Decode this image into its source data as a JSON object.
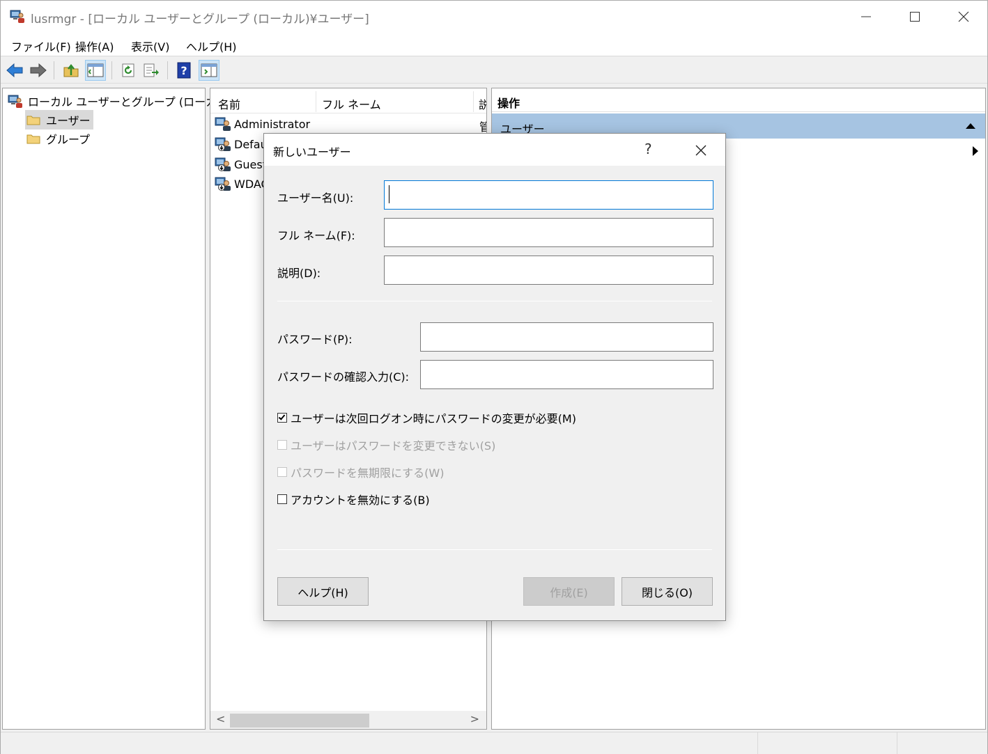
{
  "window": {
    "title": "lusrmgr - [ローカル ユーザーとグループ (ローカル)¥ユーザー]",
    "minimize": "—",
    "maximize": "☐",
    "close": "✕"
  },
  "menu": {
    "file": "ファイル(F)",
    "action": "操作(A)",
    "view": "表示(V)",
    "help": "ヘルプ(H)"
  },
  "toolbar": {
    "icons": [
      "back-icon",
      "forward-icon",
      "up-folder-icon",
      "show-hide-tree-icon",
      "refresh-icon",
      "export-list-icon",
      "help-icon",
      "show-hide-action-pane-icon"
    ]
  },
  "tree": {
    "root": "ローカル ユーザーとグループ (ローカル)",
    "users": "ユーザー",
    "groups": "グループ"
  },
  "list": {
    "columns": [
      "名前",
      "フル ネーム",
      "説"
    ],
    "rows": [
      {
        "name": "Administrator",
        "extra": "管"
      },
      {
        "name": "Defau",
        "extra": ""
      },
      {
        "name": "Guest",
        "extra": ""
      },
      {
        "name": "WDAG",
        "extra": ""
      }
    ],
    "scroll_left": "<",
    "scroll_right": ">"
  },
  "actions": {
    "title": "操作",
    "section": "ユーザー"
  },
  "dialog": {
    "title": "新しいユーザー",
    "help_glyph": "?",
    "labels": {
      "username": "ユーザー名(U):",
      "fullname": "フル ネーム(F):",
      "description": "説明(D):",
      "password": "パスワード(P):",
      "confirm": "パスワードの確認入力(C):"
    },
    "values": {
      "username": "",
      "fullname": "",
      "description": "",
      "password": "",
      "confirm": ""
    },
    "checkboxes": [
      {
        "label": "ユーザーは次回ログオン時にパスワードの変更が必要(M)",
        "checked": true,
        "disabled": false
      },
      {
        "label": "ユーザーはパスワードを変更できない(S)",
        "checked": false,
        "disabled": true
      },
      {
        "label": "パスワードを無期限にする(W)",
        "checked": false,
        "disabled": true
      },
      {
        "label": "アカウントを無効にする(B)",
        "checked": false,
        "disabled": false
      }
    ],
    "buttons": {
      "help": "ヘルプ(H)",
      "create": "作成(E)",
      "close": "閉じる(O)"
    }
  }
}
